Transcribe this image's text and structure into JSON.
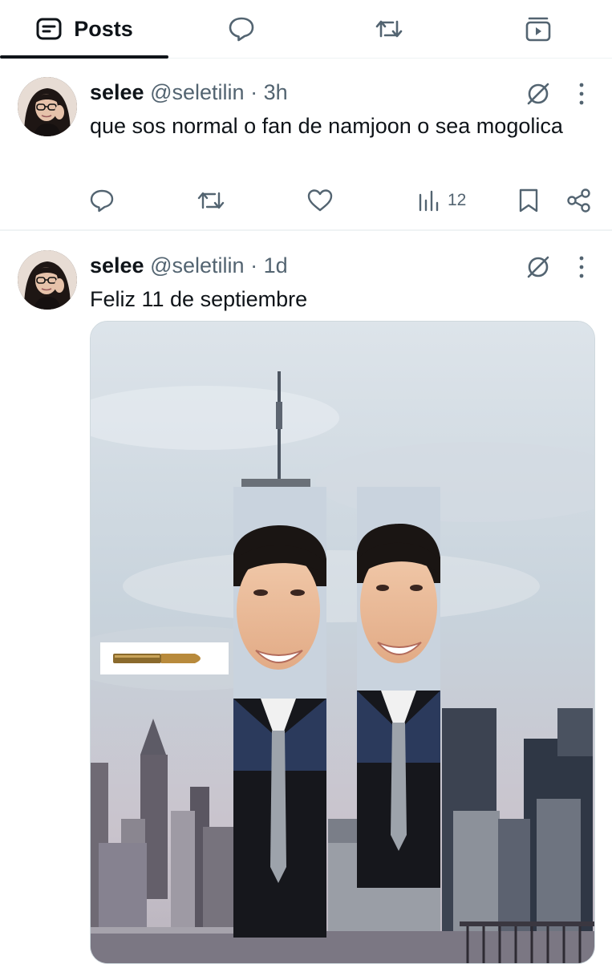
{
  "tabs": {
    "posts_label": "Posts",
    "active": "posts"
  },
  "posts": [
    {
      "name": "selee",
      "handle": "@seletilin",
      "separator": "·",
      "time": "3h",
      "text": "que sos normal o fan de namjoon o sea mogolica",
      "views": "12"
    },
    {
      "name": "selee",
      "handle": "@seletilin",
      "separator": "·",
      "time": "1d",
      "text": "Feliz 11 de septiembre"
    }
  ],
  "colors": {
    "text_primary": "#0f1419",
    "text_secondary": "#536471",
    "divider": "#eff3f4"
  }
}
